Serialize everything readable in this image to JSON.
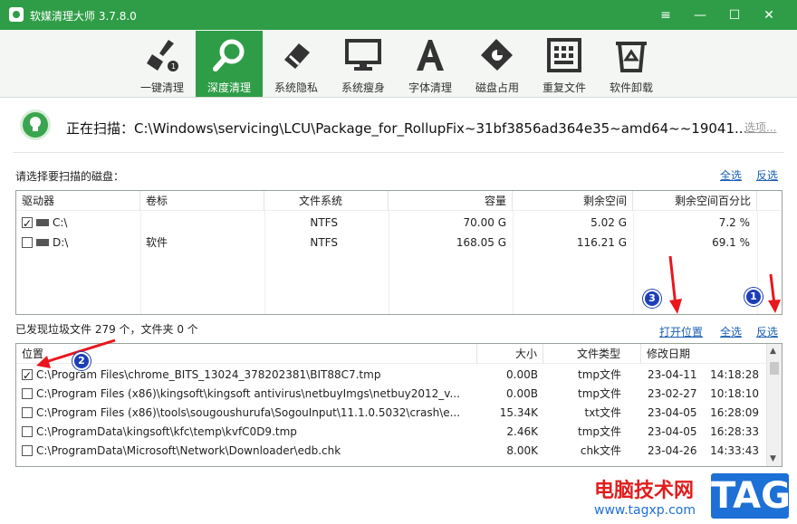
{
  "window": {
    "title": "软媒清理大师 3.7.8.0",
    "menu_icon": "≡",
    "min_icon": "—",
    "max_icon": "☐",
    "close_icon": "✕"
  },
  "toolbar": {
    "items": [
      {
        "label": "一键清理",
        "icon": "broom-icon"
      },
      {
        "label": "深度清理",
        "icon": "magnifier-icon",
        "active": true
      },
      {
        "label": "系统隐私",
        "icon": "eraser-icon"
      },
      {
        "label": "系统瘦身",
        "icon": "monitor-icon"
      },
      {
        "label": "字体清理",
        "icon": "font-icon"
      },
      {
        "label": "磁盘占用",
        "icon": "disk-tag-icon"
      },
      {
        "label": "重复文件",
        "icon": "grid-file-icon"
      },
      {
        "label": "软件卸载",
        "icon": "recycle-icon"
      }
    ]
  },
  "scan": {
    "text": "正在扫描：C:\\Windows\\servicing\\LCU\\Package_for_RollupFix~31bf3856ad364e35~amd64~~19041....",
    "options": "选项..."
  },
  "disk_section": {
    "label": "请选择要扫描的磁盘：",
    "select_all": "全选",
    "invert": "反选",
    "columns": [
      "驱动器",
      "卷标",
      "文件系统",
      "容量",
      "剩余空间",
      "剩余空间百分比"
    ],
    "rows": [
      {
        "drive": "C:\\",
        "label": "",
        "fs": "NTFS",
        "capacity": "70.00 G",
        "free": "5.02 G",
        "percent": "7.2 %",
        "checked": true
      },
      {
        "drive": "D:\\",
        "label": "软件",
        "fs": "NTFS",
        "capacity": "168.05 G",
        "free": "116.21 G",
        "percent": "69.1 %",
        "checked": false
      }
    ]
  },
  "file_section": {
    "status": "已发现垃圾文件 279 个，文件夹 0 个",
    "open_location": "打开位置",
    "select_all": "全选",
    "invert": "反选",
    "columns": [
      "位置",
      "大小",
      "文件类型",
      "修改日期"
    ],
    "rows": [
      {
        "path": "C:\\Program Files\\chrome_BITS_13024_378202381\\BIT88C7.tmp",
        "size": "0.00B",
        "type": "tmp文件",
        "date": "23-04-11",
        "time": "14:18:28",
        "checked": true
      },
      {
        "path": "C:\\Program Files (x86)\\kingsoft\\kingsoft antivirus\\netbuyImgs\\netbuy2012_v...",
        "size": "0.00B",
        "type": "tmp文件",
        "date": "23-02-27",
        "time": "10:18:10",
        "checked": false
      },
      {
        "path": "C:\\Program Files (x86)\\tools\\sougoushurufa\\SogouInput\\11.1.0.5032\\crash\\e...",
        "size": "15.34K",
        "type": "txt文件",
        "date": "23-04-05",
        "time": "16:28:09",
        "checked": false
      },
      {
        "path": "C:\\ProgramData\\kingsoft\\kfc\\temp\\kvfC0D9.tmp",
        "size": "2.46K",
        "type": "tmp文件",
        "date": "23-04-05",
        "time": "16:28:33",
        "checked": false
      },
      {
        "path": "C:\\ProgramData\\Microsoft\\Network\\Downloader\\edb.chk",
        "size": "8.00K",
        "type": "chk文件",
        "date": "23-04-26",
        "time": "14:33:43",
        "checked": false
      }
    ]
  },
  "annotations": {
    "badge1": "1",
    "badge2": "2",
    "badge3": "3"
  },
  "watermark": {
    "site": "电脑技术网",
    "url": "www.tagxp.com",
    "tag": "TAG"
  },
  "colors": {
    "accent": "#2f9d47",
    "link": "#1a5fb4",
    "arrow": "#e8171d",
    "badge": "#1c3fb8"
  }
}
